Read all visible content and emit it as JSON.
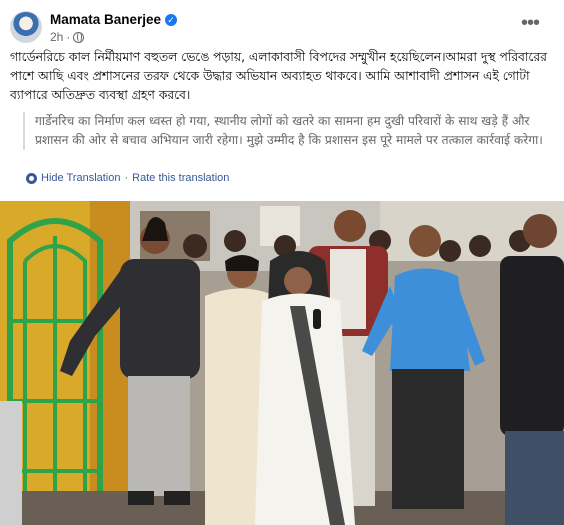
{
  "post": {
    "author": "Mamata Banerjee",
    "time": "2h",
    "verified_mark": "✓",
    "more_glyph": "•••",
    "text": "গার্ডেনরিচে কাল নির্মীয়মাণ বহুতল ভেঙে পড়ায়, এলাকাবাসী বিপদের সম্মুখীন হয়েছিলেন।আমরা দুস্থ পরিবারের পাশে আছি এবং প্রশাসনের তরফ থেকে উদ্ধার অভিযান অব্যাহত থাকবে। আমি আশাবাদী প্রশাসন এই গোটা ব্যাপারে অতিদ্রুত ব্যবস্থা গ্রহণ করবে।",
    "translated_text": "गार्डेनरिच का निर्माण कल ध्वस्त हो गया, स्थानीय लोगों को खतरे का सामना हम दुखी परिवारों के साथ खड़े हैं और प्रशासन की ओर से बचाव अभियान जारी रहेगा। मुझे उम्मीद है कि प्रशासन इस पूरे मामले पर तत्काल कार्रवाई करेगा।",
    "hide_translation": "Hide Translation",
    "separator": "·",
    "rate_translation": "Rate this translation"
  },
  "icons": {
    "avatar": "profile-avatar",
    "verified": "verified-badge-icon",
    "privacy": "globe-icon",
    "more": "more-options-icon",
    "translate": "translate-gear-icon"
  },
  "colors": {
    "link": "#385898",
    "secondary_text": "#65676b",
    "verified": "#1877f2"
  }
}
